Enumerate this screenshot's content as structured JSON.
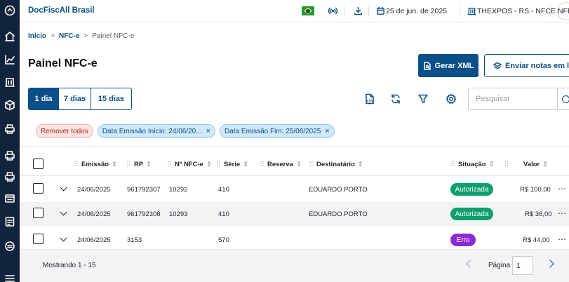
{
  "app": {
    "brand": "DocFiscAll Brasil"
  },
  "topbar": {
    "date": "25 de jun. de 2025",
    "company": "THEXPOS - RS - NFCE NFE",
    "icons": [
      "brazil-flag",
      "wireless-icon",
      "download-icon",
      "calendar-icon",
      "building-icon"
    ]
  },
  "sidebar": {
    "icons": [
      "app-logo-icon",
      "home-icon",
      "chart-icon",
      "building-icon",
      "box-icon",
      "printer-icon",
      "printer-icon",
      "printer-icon",
      "receipt-icon",
      "document-icon",
      "coin-icon",
      "menu-icon"
    ]
  },
  "breadcrumb": {
    "home": "Início",
    "section": "NFC-e",
    "current": "Painel NFC-e",
    "separator": ">"
  },
  "page": {
    "title": "Painel NFC-e"
  },
  "actions": {
    "gerar_xml": "Gerar XML",
    "enviar_lote": "Enviar notas em lote"
  },
  "period": {
    "options": [
      "1 dia",
      "7 dias",
      "15 dias"
    ],
    "selected": "1 dia"
  },
  "toolbar": {
    "csv_label": "CSV",
    "search_placeholder": "Pesquisar"
  },
  "filters": {
    "remove_all": "Remover todos",
    "chips": [
      {
        "label": "Data Emissão Início: 24/06/20...",
        "close": "×"
      },
      {
        "label": "Data Emissão Fim: 25/06/2025",
        "close": "×"
      }
    ]
  },
  "table": {
    "columns": {
      "emissao": "Emissão",
      "rp": "RP",
      "numero": "Nº NFC-e",
      "serie": "Série",
      "reserva": "Reserva",
      "destinatario": "Destinatário",
      "situacao": "Situação",
      "valor": "Valor"
    },
    "rows": [
      {
        "emissao": "24/06/2025",
        "rp": "961792307",
        "numero": "10292",
        "serie": "410",
        "reserva": "",
        "destinatario": "EDUARDO PORTO",
        "situacao": "Autorizada",
        "valor": "R$ 100,00"
      },
      {
        "emissao": "24/06/2025",
        "rp": "961792308",
        "numero": "10293",
        "serie": "410",
        "reserva": "",
        "destinatario": "EDUARDO PORTO",
        "situacao": "Autorizada",
        "valor": "R$ 36,00"
      },
      {
        "emissao": "24/06/2025",
        "rp": "3153",
        "numero": "",
        "serie": "570",
        "reserva": "",
        "destinatario": "",
        "situacao": "Erro",
        "valor": "R$ 44,00"
      }
    ],
    "more_glyph": "⋯"
  },
  "footer": {
    "showing": "Mostrando 1 - 15",
    "page_label": "Página",
    "page_value": "1"
  },
  "colors": {
    "primary": "#0b4f8a",
    "success": "#0e9f6e",
    "error": "#8b2bd1",
    "sidebar": "#10243d"
  }
}
